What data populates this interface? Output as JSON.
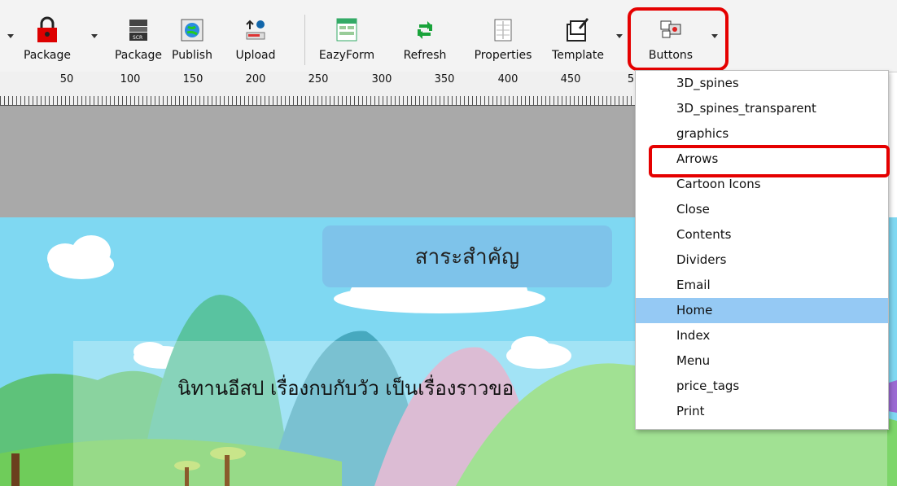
{
  "toolbar": {
    "buttons": [
      {
        "label": "Package",
        "icon": "lock-icon"
      },
      {
        "label": "Package",
        "icon": "scorm-package-icon"
      },
      {
        "label": "Publish",
        "icon": "globe-icon"
      },
      {
        "label": "Upload",
        "icon": "upload-icon"
      },
      {
        "label": "EazyForm",
        "icon": "form-icon"
      },
      {
        "label": "Refresh",
        "icon": "refresh-icon"
      },
      {
        "label": "Properties",
        "icon": "properties-icon"
      },
      {
        "label": "Template",
        "icon": "template-icon"
      },
      {
        "label": "Buttons",
        "icon": "buttons-icon"
      }
    ]
  },
  "ruler": {
    "marks": [
      "50",
      "100",
      "150",
      "200",
      "250",
      "300",
      "350",
      "400",
      "450",
      "5"
    ]
  },
  "scene": {
    "title": "สาระสำคัญ",
    "story_text": "นิทานอีสป เรื่องกบกับวัว เป็นเรื่องราวขอ"
  },
  "dropdown": {
    "items": [
      "3D_spines",
      "3D_spines_transparent",
      "graphics",
      "Arrows",
      "Cartoon Icons",
      "Close",
      "Contents",
      "Dividers",
      "Email",
      "Home",
      "Index",
      "Menu",
      "price_tags",
      "Print"
    ],
    "selected": "Home",
    "highlighted": "Arrows"
  },
  "colors": {
    "highlight": "#e50000",
    "selection": "#95c9f4",
    "sky": "#7fd8f2"
  }
}
